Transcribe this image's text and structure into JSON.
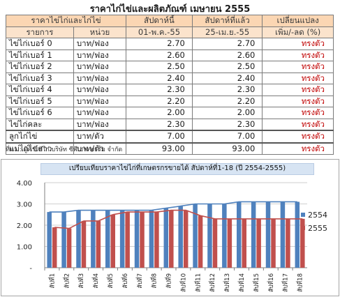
{
  "title": "ราคาไก่ไข่และผลิตภัณฑ์ เมษายน 2555",
  "table": {
    "header1": [
      "ราคาไข่ไก่และไก่ไข่",
      "สัปดาห์นี้",
      "สัปดาห์ที่แล้ว",
      "เปลี่ยนแปลง"
    ],
    "header2": [
      "รายการ",
      "หน่วย",
      "01-พ.ค.-55",
      "25-เม.ย.-55",
      "เพิ่ม/-ลด (%)"
    ],
    "rows": [
      {
        "name": "ไข่ไก่เบอร์ 0",
        "unit": "บาท/ฟอง",
        "this_week": "2.70",
        "last_week": "2.70",
        "change": "ทรงตัว"
      },
      {
        "name": "ไข่ไก่เบอร์ 1",
        "unit": "บาท/ฟอง",
        "this_week": "2.60",
        "last_week": "2.60",
        "change": "ทรงตัว"
      },
      {
        "name": "ไข่ไก่เบอร์ 2",
        "unit": "บาท/ฟอง",
        "this_week": "2.50",
        "last_week": "2.50",
        "change": "ทรงตัว"
      },
      {
        "name": "ไข่ไก่เบอร์ 3",
        "unit": "บาท/ฟอง",
        "this_week": "2.40",
        "last_week": "2.40",
        "change": "ทรงตัว"
      },
      {
        "name": "ไข่ไก่เบอร์ 4",
        "unit": "บาท/ฟอง",
        "this_week": "2.30",
        "last_week": "2.30",
        "change": "ทรงตัว"
      },
      {
        "name": "ไข่ไก่เบอร์ 5",
        "unit": "บาท/ฟอง",
        "this_week": "2.20",
        "last_week": "2.20",
        "change": "ทรงตัว"
      },
      {
        "name": "ไข่ไก่เบอร์ 6",
        "unit": "บาท/ฟอง",
        "this_week": "2.00",
        "last_week": "2.00",
        "change": "ทรงตัว"
      },
      {
        "name": "ไข่ไก่คละ",
        "unit": "บาท/ฟอง",
        "this_week": "2.30",
        "last_week": "2.30",
        "change": "ทรงตัว"
      },
      {
        "name": "ลูกไก่ไข่",
        "unit": "บาท/ตัว",
        "this_week": "7.00",
        "last_week": "7.00",
        "change": "ทรงตัว"
      },
      {
        "name": "แม่ไก่ไข่สาว",
        "unit": "บาท/ตัว",
        "this_week": "93.00",
        "last_week": "93.00",
        "change": "ทรงตัว"
      }
    ]
  },
  "source": "ที่มา : ผู้ค้าไข่ไก่ บริษัท ซีพีเอฟ ฟาร์ม จำกัด",
  "colors": {
    "series_2554": "#4f81bd",
    "series_2555": "#c0504d",
    "header_bg": "#fbd6b3"
  },
  "chart_data": {
    "type": "bar",
    "title": "เปรียบเทียบราคาไข่ไก่ที่เกษตรกรขายได้ สัปดาห์ที่1-18 (ปี 2554-2555)",
    "categories": [
      "สัปที่1",
      "สัปที่2",
      "สัปที่3",
      "สัปที่4",
      "สัปที่5",
      "สัปที่6",
      "สัปที่7",
      "สัปที่8",
      "สัปที่9",
      "สัปที่10",
      "สัปที่11",
      "สัปที่12",
      "สัปที่13",
      "สัปที่14",
      "สัปที่15",
      "สัปที่16",
      "สัปที่17",
      "สัปที่18"
    ],
    "series": [
      {
        "name": "2554",
        "values": [
          2.62,
          2.62,
          2.7,
          2.7,
          2.7,
          2.7,
          2.7,
          2.7,
          2.8,
          2.9,
          3.0,
          3.0,
          3.0,
          3.1,
          3.1,
          3.1,
          3.1,
          3.1
        ]
      },
      {
        "name": "2555",
        "values": [
          1.9,
          1.85,
          2.2,
          2.2,
          2.5,
          2.62,
          2.62,
          2.62,
          2.7,
          2.7,
          2.45,
          2.3,
          2.3,
          2.3,
          2.3,
          2.3,
          2.3,
          2.3
        ]
      }
    ],
    "ylim": [
      0,
      4
    ],
    "yticks": [
      "4.00",
      "3.00",
      "2.00",
      "1.00",
      "-"
    ],
    "legend": "right"
  }
}
